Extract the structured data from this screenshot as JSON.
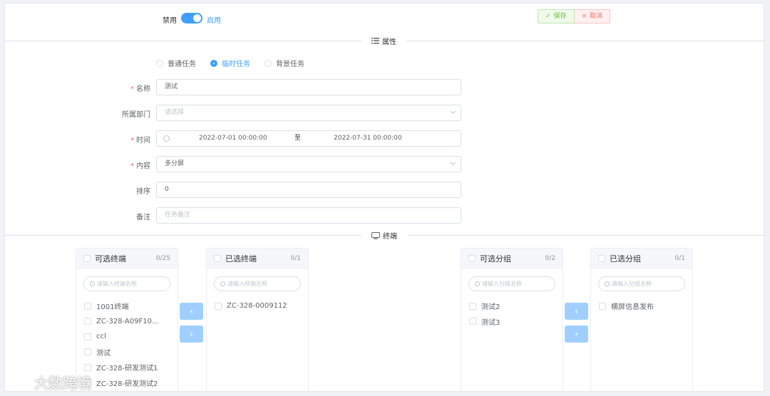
{
  "status": {
    "disabled_label": "禁用",
    "enabled_label": "启用"
  },
  "actions": {
    "save_label": "保存",
    "cancel_label": "取消",
    "save_icon": "✓",
    "cancel_icon": "×"
  },
  "sections": {
    "properties": "属性",
    "terminals": "终端"
  },
  "task_types": [
    {
      "label": "普通任务",
      "checked": false
    },
    {
      "label": "临时任务",
      "checked": true
    },
    {
      "label": "背景任务",
      "checked": false
    }
  ],
  "form": {
    "name": {
      "label": "名称",
      "value": "测试",
      "required": true
    },
    "department": {
      "label": "所属部门",
      "placeholder": "请选择"
    },
    "time": {
      "label": "时间",
      "start": "2022-07-01 00:00:00",
      "separator": "至",
      "end": "2022-07-31 00:00:00",
      "required": true
    },
    "content": {
      "label": "内容",
      "value": "多分屏",
      "required": true
    },
    "order": {
      "label": "排序",
      "value": "0"
    },
    "remark": {
      "label": "备注",
      "placeholder": "任务备注"
    }
  },
  "transfers": {
    "available_terminals": {
      "title": "可选终端",
      "count": "0/25",
      "search_placeholder": "请输入终端名称",
      "items": [
        "1001终端",
        "ZC-328-A09F10...",
        "ccl",
        "测试",
        "ZC-328-研发测试1",
        "ZC-328-研发测试2"
      ]
    },
    "selected_terminals": {
      "title": "已选终端",
      "count": "0/1",
      "search_placeholder": "请输入终端名称",
      "items": [
        "ZC-328-0009112"
      ]
    },
    "available_groups": {
      "title": "可选分组",
      "count": "0/2",
      "search_placeholder": "请输入分组名称",
      "items": [
        "测试2",
        "测试3"
      ]
    },
    "selected_groups": {
      "title": "已选分组",
      "count": "0/1",
      "search_placeholder": "请输入分组名称",
      "items": [
        "横屏信息发布"
      ]
    },
    "arrow_left": "‹",
    "arrow_right": "›"
  },
  "watermark": "大数跨境",
  "colors": {
    "primary": "#409eff",
    "success": "#67c23a",
    "danger": "#f56c6c",
    "disabled_primary": "#a0cfff"
  }
}
